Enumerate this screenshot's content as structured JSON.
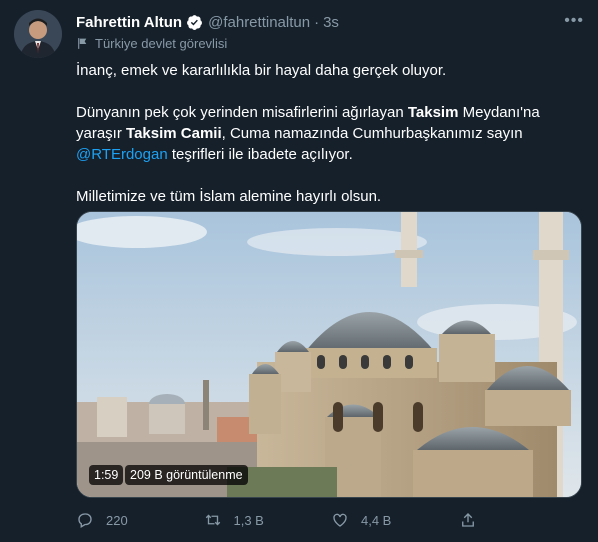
{
  "tweet": {
    "author_name": "Fahrettin Altun",
    "handle": "@fahrettinaltun",
    "separator": "·",
    "time": "3s",
    "account_label": "Türkiye devlet görevlisi",
    "line1": "İnanç, emek ve kararlılıkla bir hayal daha gerçek oluyor.",
    "para2_a": "Dünyanın pek çok yerinden misafirlerini ağırlayan ",
    "para2_b": "Taksim",
    "para2_c": " Meydanı'na yaraşır ",
    "para2_d": "Taksim Camii",
    "para2_e": ", Cuma namazında Cumhurbaşkanımız sayın ",
    "para2_mention": "@RTErdogan",
    "para2_f": " teşrifleri ile ibadete açılıyor.",
    "line3": "Milletimize ve tüm İslam alemine hayırlı olsun."
  },
  "media": {
    "duration": "1:59",
    "views": "209 B görüntülenme"
  },
  "actions": {
    "replies": "220",
    "retweets": "1,3 B",
    "likes": "4,4 B"
  },
  "colors": {
    "background": "#15202b",
    "muted": "#8899a6",
    "link": "#1da1f2"
  }
}
